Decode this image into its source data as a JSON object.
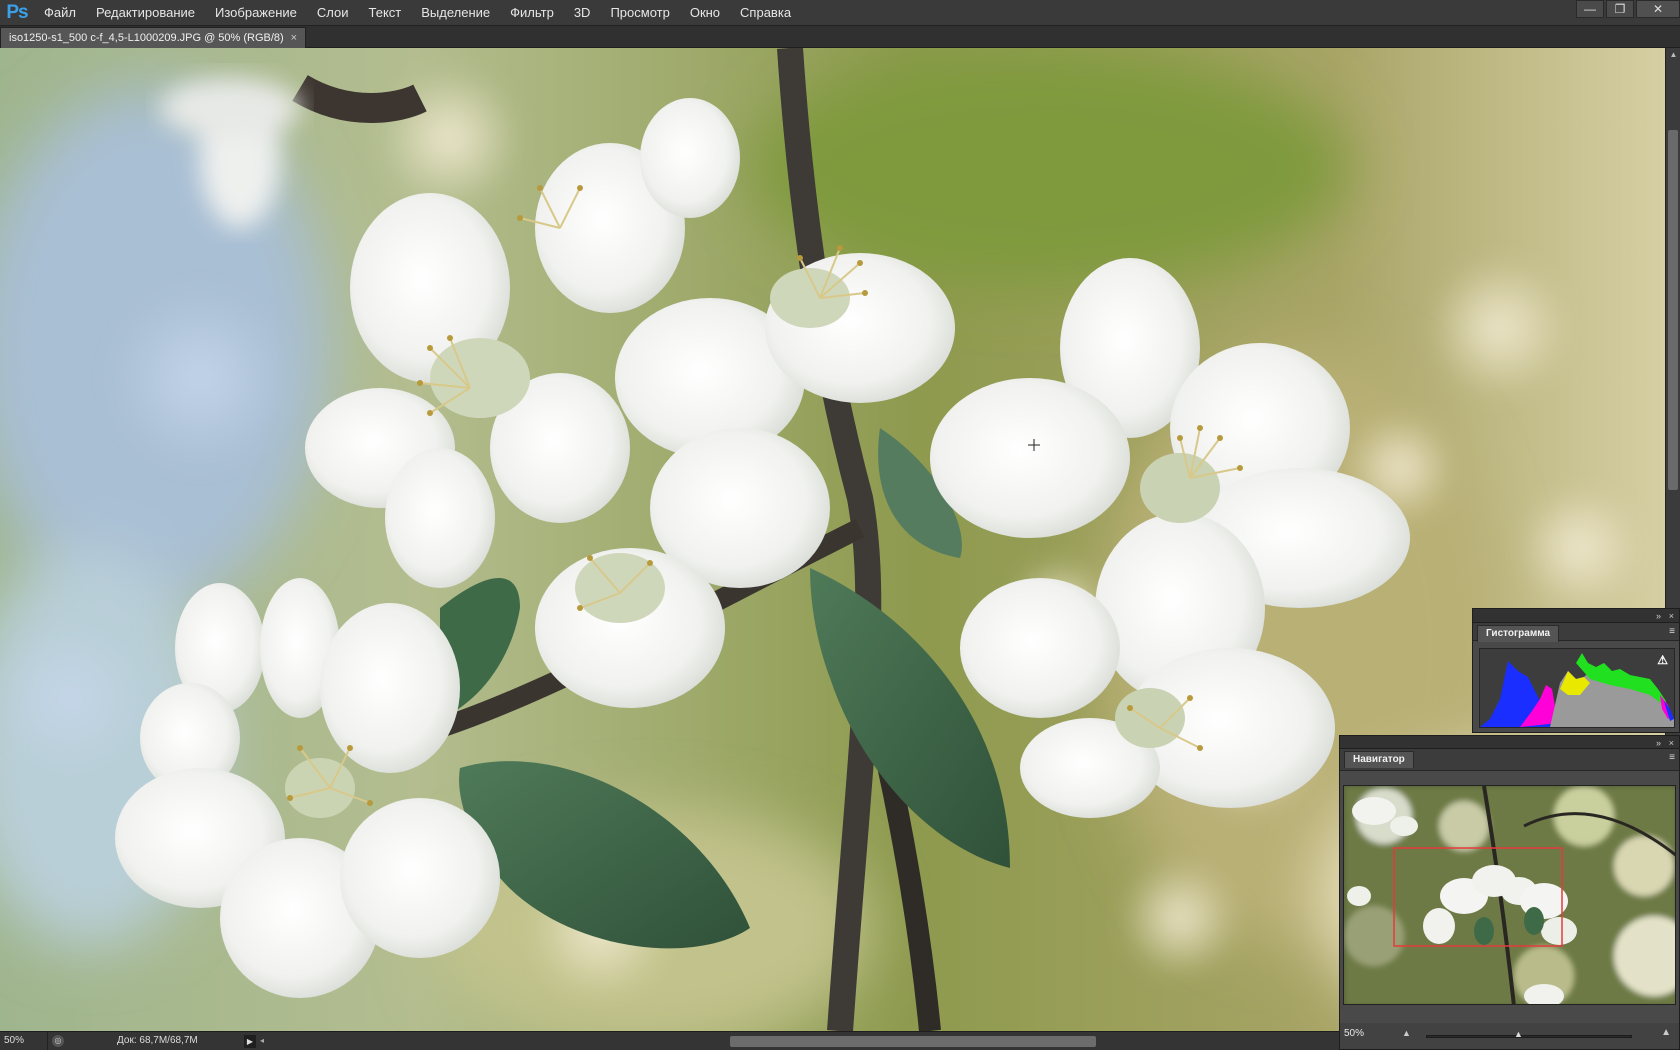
{
  "app": {
    "logo": "Ps",
    "menu": [
      "Файл",
      "Редактирование",
      "Изображение",
      "Слои",
      "Текст",
      "Выделение",
      "Фильтр",
      "3D",
      "Просмотр",
      "Окно",
      "Справка"
    ],
    "window_controls": {
      "minimize": "—",
      "restore": "❐",
      "close": "✕"
    }
  },
  "document": {
    "tab_title": "iso1250-s1_500 c-f_4,5-L1000209.JPG @ 50% (RGB/8)",
    "tab_close": "×"
  },
  "statusbar": {
    "zoom": "50%",
    "doc_size": "Док: 68,7M/68,7M",
    "play_icon": "▶",
    "scroll_left_icon": "◂"
  },
  "panels": {
    "histogram": {
      "tab": "Гистограмма",
      "warning_icon": "⚠",
      "menu_icon": "≡",
      "collapse_icon": "»",
      "close_icon": "×"
    },
    "navigator": {
      "tab": "Навигатор",
      "zoom": "50%",
      "menu_icon": "≡",
      "collapse_icon": "»",
      "close_icon": "×",
      "zoom_out_icon": "▲",
      "zoom_in_icon": "▲",
      "slider_icon": "▲",
      "zoom_level": 0.5
    }
  },
  "scrollbar": {
    "up_icon": "▲",
    "down_icon": "▼"
  },
  "colors": {
    "accent_blue": "#3aa0e8",
    "navigator_box": "#e43b3b",
    "histogram_blue": "#1a2eff",
    "histogram_magenta": "#ff00d8",
    "histogram_yellow": "#e8e800",
    "histogram_green": "#20e020",
    "histogram_gray": "#9a9a9a"
  },
  "icons": {
    "cursor": "crosshair-cursor-icon"
  }
}
